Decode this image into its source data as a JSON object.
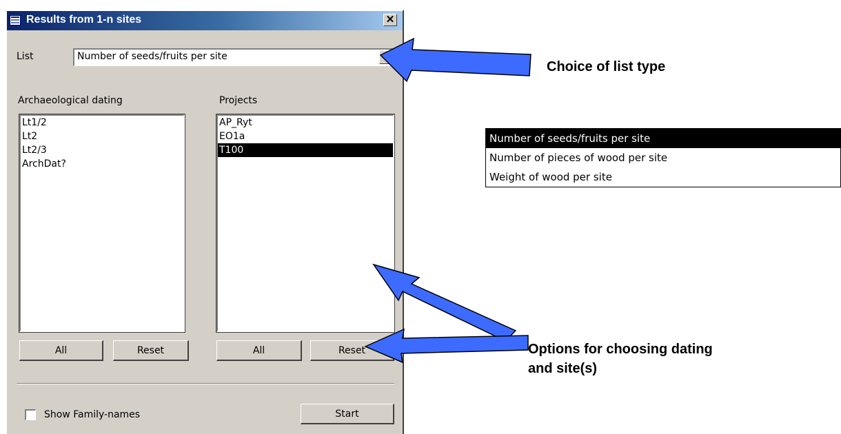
{
  "dialog": {
    "title": "Results from 1-n sites",
    "close_label": "✕",
    "list_label": "List",
    "list_value": "Number of seeds/fruits per site",
    "dating": {
      "label": "Archaeological dating",
      "items": [
        "Lt1/2",
        "Lt2",
        "Lt2/3",
        "ArchDat?"
      ],
      "all_label": "All",
      "reset_label": "Reset"
    },
    "projects": {
      "label": "Projects",
      "items": [
        "AP_Ryt",
        "EO1a",
        "T100"
      ],
      "selected": "T100",
      "all_label": "All",
      "reset_label": "Reset"
    },
    "show_family_label": "Show Family-names",
    "start_label": "Start"
  },
  "dropdown": {
    "options": [
      "Number of seeds/fruits per site",
      "Number of pieces of wood  per site",
      "Weight of wood  per site"
    ],
    "selected": "Number of seeds/fruits per site"
  },
  "annotations": {
    "choice": "Choice of list type",
    "options_line1": "Options for choosing dating",
    "options_line2": "and site(s)"
  },
  "colors": {
    "dialog_bg": "#d4d0c8",
    "titlebar_start": "#0a246a",
    "titlebar_end": "#a6caf0",
    "arrow_fill": "#3d6bff",
    "selection": "#000000"
  },
  "icons": {
    "app": "form-icon",
    "close": "close-icon",
    "combo_arrow": "chevron-down-icon",
    "checkbox": "checkbox-icon"
  }
}
